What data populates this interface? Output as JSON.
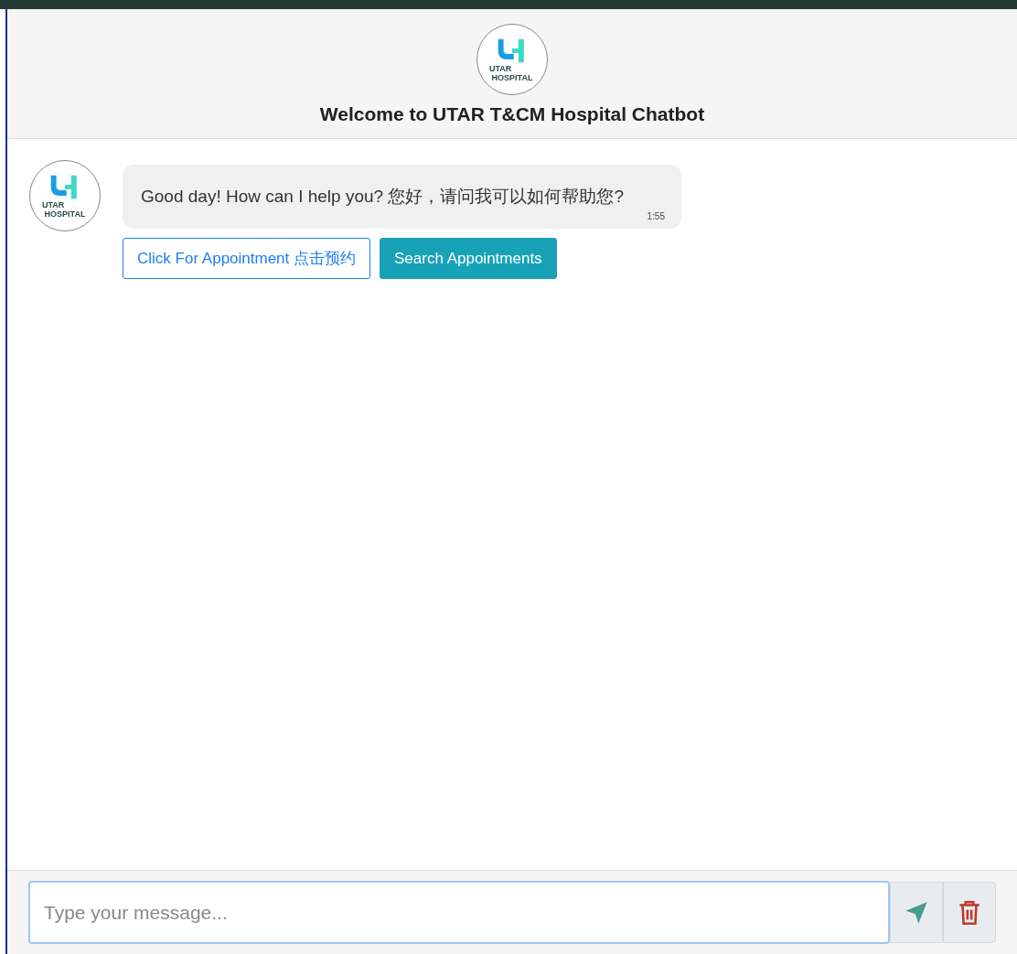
{
  "header": {
    "logo": {
      "line_1": "UTAR",
      "line_2": "HOSPITAL"
    },
    "title": "Welcome to UTAR T&CM Hospital Chatbot"
  },
  "messages": [
    {
      "kind": "bot",
      "avatar": {
        "line_1": "UTAR",
        "line_2": "HOSPITAL"
      },
      "text": "Good day! How can I help you? 您好，请问我可以如何帮助您?",
      "time": "1:55",
      "buttons": [
        {
          "label": "Click For Appointment 点击预约",
          "kind": "outline"
        },
        {
          "label": "Search Appointments",
          "kind": "solid"
        }
      ]
    }
  ],
  "composer": {
    "placeholder": "Type your message..."
  }
}
